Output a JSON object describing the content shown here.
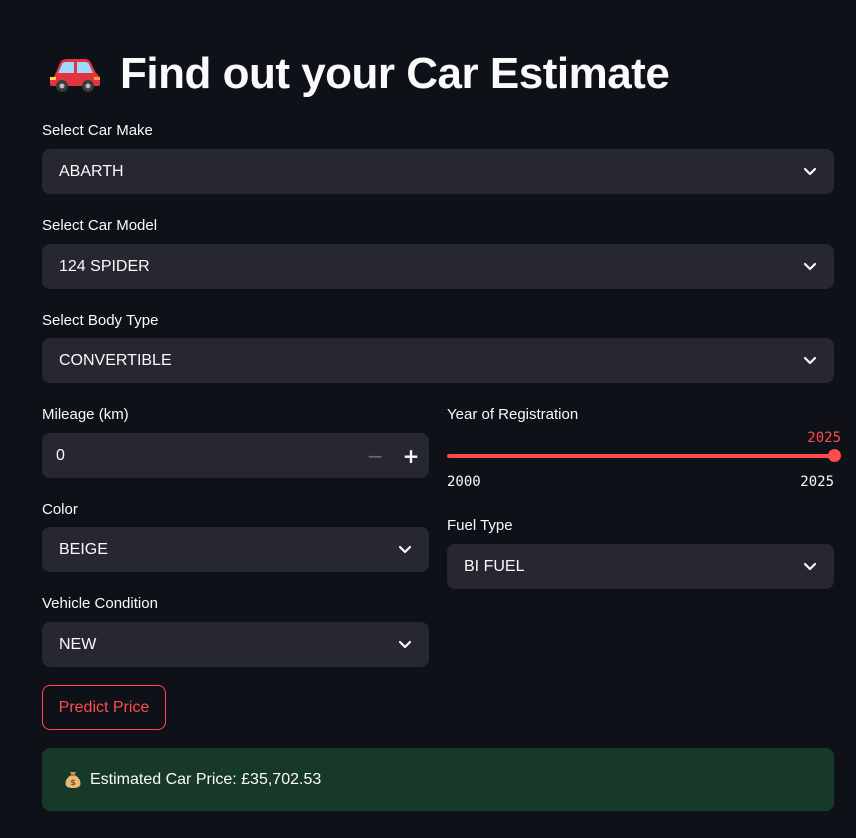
{
  "header": {
    "icon": "red-car-icon",
    "title": "Find out your Car Estimate"
  },
  "make": {
    "label": "Select Car Make",
    "value": "ABARTH"
  },
  "model": {
    "label": "Select Car Model",
    "value": "124 SPIDER"
  },
  "body_type": {
    "label": "Select Body Type",
    "value": "CONVERTIBLE"
  },
  "mileage": {
    "label": "Mileage (km)",
    "value": "0",
    "minus": "−",
    "plus": "+"
  },
  "year": {
    "label": "Year of Registration",
    "value": "2025",
    "min": "2000",
    "max": "2025",
    "fraction": 1.0
  },
  "color": {
    "label": "Color",
    "value": "BEIGE"
  },
  "fuel": {
    "label": "Fuel Type",
    "value": "BI FUEL"
  },
  "condition": {
    "label": "Vehicle Condition",
    "value": "NEW"
  },
  "predict_button": {
    "label": "Predict Price"
  },
  "result": {
    "icon": "money-bag-icon",
    "text": "Estimated Car Price: £35,702.53"
  },
  "colors": {
    "accent": "#ff4b4b",
    "background": "#0e1117",
    "input_bg": "#262730",
    "success_bg": "#173928"
  }
}
